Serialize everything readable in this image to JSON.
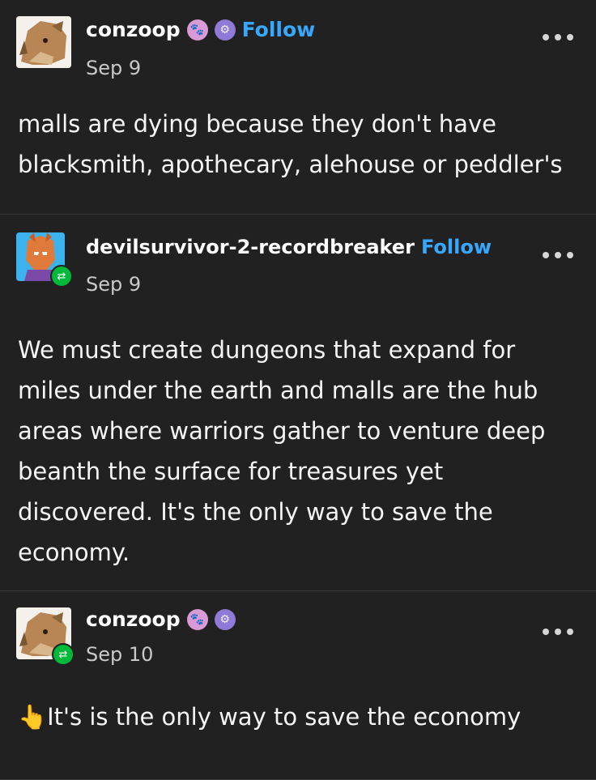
{
  "posts": [
    {
      "username": "conzoop",
      "follow_label": "Follow",
      "date": "Sep 9",
      "text": "malls are dying because they don't have blacksmith, apothecary, alehouse or peddler's",
      "emoji": "",
      "reblogged": false
    },
    {
      "username": "devilsurvivor-2-recordbreaker",
      "follow_label": "Follow",
      "date": "Sep 9",
      "text": "We must create dungeons that expand for miles under the earth and malls are the hub areas where warriors gather to venture deep beanth the surface for treasures yet discovered. It's the only way to save the economy.",
      "emoji": "",
      "reblogged": true
    },
    {
      "username": "conzoop",
      "follow_label": "",
      "date": "Sep 10",
      "text": "It's is the only way to save the economy",
      "emoji": "👆",
      "reblogged": true
    }
  ],
  "icons": {
    "more": "more-options-icon",
    "reblog": "reblog-icon",
    "badge_paw": "paw-badge-icon",
    "badge_gear": "gear-badge-icon"
  },
  "colors": {
    "background": "#212121",
    "follow": "#38a8ff",
    "reblog": "#00b83a"
  }
}
